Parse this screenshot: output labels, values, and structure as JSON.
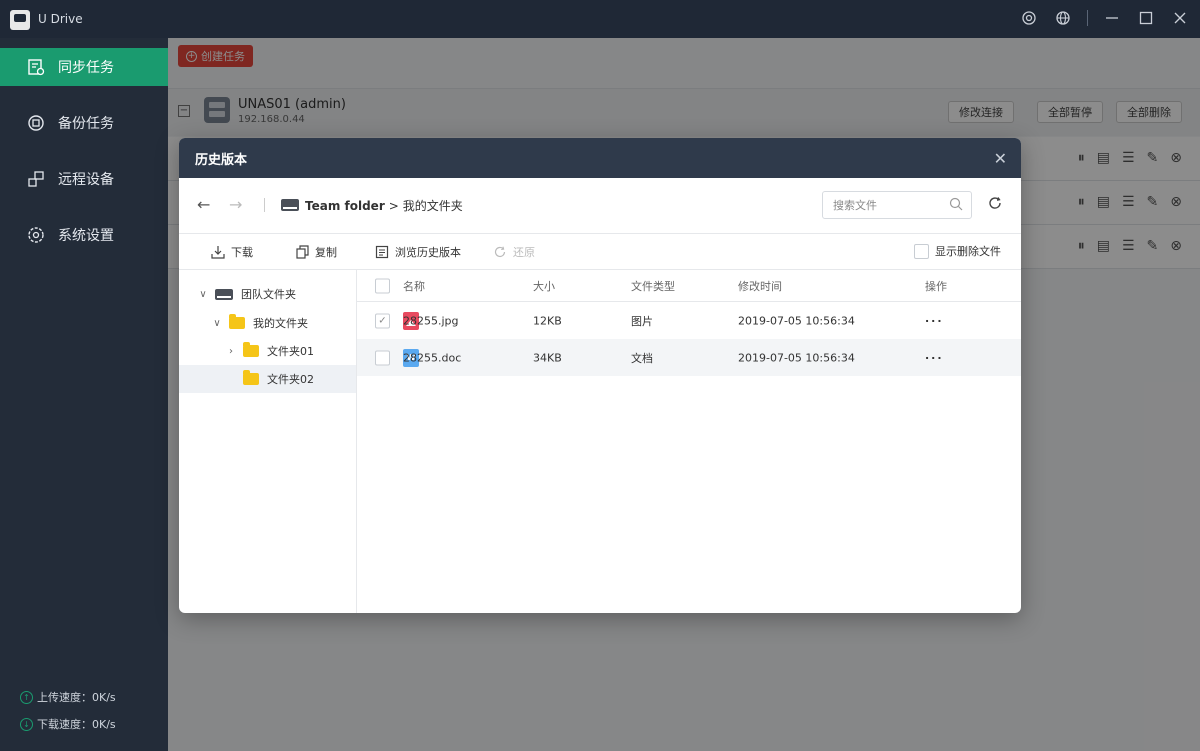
{
  "app": {
    "title": "U Drive"
  },
  "titlebar": {
    "icons": [
      "settings-icon",
      "globe-icon",
      "minimize-icon",
      "maximize-icon",
      "close-icon"
    ]
  },
  "sidebar": {
    "items": [
      {
        "label": "同步任务",
        "icon": "sync-task-icon",
        "active": true
      },
      {
        "label": "备份任务",
        "icon": "backup-icon",
        "active": false
      },
      {
        "label": "远程设备",
        "icon": "remote-device-icon",
        "active": false
      },
      {
        "label": "系统设置",
        "icon": "settings-icon",
        "active": false
      }
    ],
    "upload_speed": "上传速度：0K/s",
    "download_speed": "下载速度：0K/s"
  },
  "main": {
    "create_button": "创建任务",
    "nas": {
      "name": "UNAS01 (admin)",
      "ip": "192.168.0.44"
    },
    "header_buttons": {
      "modify": "修改连接",
      "pause_all": "全部暂停",
      "delete_all": "全部删除"
    }
  },
  "dialog": {
    "title": "历史版本",
    "path": {
      "root": "Team folder",
      "separator": ">",
      "current": "我的文件夹"
    },
    "search": {
      "placeholder": "搜索文件"
    },
    "toolbar": {
      "download": "下载",
      "copy": "复制",
      "browse_history": "浏览历史版本",
      "restore": "还原",
      "show_deleted": "显示删除文件"
    },
    "tree": [
      {
        "label": "团队文件夹",
        "level": 0,
        "type": "drive",
        "expanded": true
      },
      {
        "label": "我的文件夹",
        "level": 1,
        "type": "folder",
        "expanded": true
      },
      {
        "label": "文件夹01",
        "level": 2,
        "type": "folder",
        "expanded": false
      },
      {
        "label": "文件夹02",
        "level": 2,
        "type": "folder",
        "selected": true
      }
    ],
    "columns": {
      "name": "名称",
      "size": "大小",
      "type": "文件类型",
      "modified": "修改时间",
      "actions": "操作"
    },
    "files": [
      {
        "name": "28255.jpg",
        "size": "12KB",
        "type": "图片",
        "modified": "2019-07-05 10:56:34",
        "actions": "···",
        "checked": true,
        "icon": "image-file-icon"
      },
      {
        "name": "28255.doc",
        "size": "34KB",
        "type": "文档",
        "modified": "2019-07-05 10:56:34",
        "actions": "···",
        "checked": false,
        "icon": "word-file-icon"
      }
    ]
  },
  "colors": {
    "accent": "#1a9b6f",
    "danger": "#e7473c",
    "sidebar": "#232c39",
    "dialog_header": "#2f3a4b"
  }
}
